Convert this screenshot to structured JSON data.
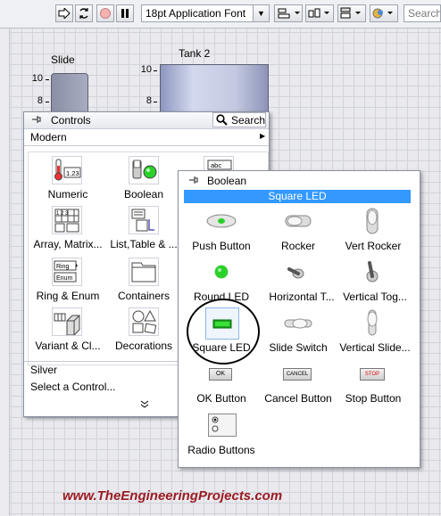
{
  "toolbar": {
    "font": "18pt Application Font",
    "search_placeholder": "Search",
    "icons": [
      "run-arrow-icon",
      "run-continuously-icon",
      "abort-icon",
      "pause-icon",
      "align-objects-icon",
      "distribute-objects-icon",
      "resize-objects-icon",
      "reorder-icon"
    ]
  },
  "front_panel": {
    "slide": {
      "label": "Slide",
      "ticks": [
        "10",
        "8"
      ]
    },
    "tank": {
      "label": "Tank 2",
      "ticks": [
        "10",
        "8"
      ]
    }
  },
  "controls_palette": {
    "title": "Controls",
    "search_label": "Search",
    "category": "Modern",
    "items": [
      {
        "label": "Numeric",
        "icon": "numeric-icon"
      },
      {
        "label": "Boolean",
        "icon": "boolean-icon"
      },
      {
        "label": "Array, Matrix...",
        "icon": "array-matrix-icon"
      },
      {
        "label": "List,Table & ...",
        "icon": "list-table-icon"
      },
      {
        "label": "Ring & Enum",
        "icon": "ring-enum-icon"
      },
      {
        "label": "Containers",
        "icon": "containers-icon"
      },
      {
        "label": "Variant & Cl...",
        "icon": "variant-class-icon"
      },
      {
        "label": "Decorations",
        "icon": "decorations-icon"
      }
    ],
    "icon_text": {
      "numeric": "1.23",
      "ring": "Ring",
      "enum": "Enum",
      "string": "abc"
    },
    "silver": "Silver",
    "select_control": "Select a Control...",
    "more": "»"
  },
  "boolean_palette": {
    "title": "Boolean",
    "highlight": "Square LED",
    "items": [
      {
        "label": "Push Button",
        "icon": "push-button-icon"
      },
      {
        "label": "Rocker",
        "icon": "rocker-icon"
      },
      {
        "label": "Vert Rocker",
        "icon": "vert-rocker-icon"
      },
      {
        "label": "Round LED",
        "icon": "round-led-icon"
      },
      {
        "label": "Horizontal T...",
        "icon": "horizontal-toggle-icon"
      },
      {
        "label": "Vertical Tog...",
        "icon": "vertical-toggle-icon"
      },
      {
        "label": "Square LED",
        "icon": "square-led-icon"
      },
      {
        "label": "Slide Switch",
        "icon": "slide-switch-icon"
      },
      {
        "label": "Vertical Slide...",
        "icon": "vertical-slide-icon"
      },
      {
        "label": "OK Button",
        "icon": "ok-button-icon"
      },
      {
        "label": "Cancel Button",
        "icon": "cancel-button-icon"
      },
      {
        "label": "Stop Button",
        "icon": "stop-button-icon"
      },
      {
        "label": "Radio Buttons",
        "icon": "radio-buttons-icon"
      }
    ],
    "button_text": {
      "ok": "OK",
      "cancel": "CANCEL",
      "stop": "STOP"
    }
  },
  "watermark": "www.TheEngineeringProjects.com",
  "colors": {
    "highlight": "#3399ff",
    "led_green": "#22cc22",
    "watermark": "#9b1b20"
  }
}
